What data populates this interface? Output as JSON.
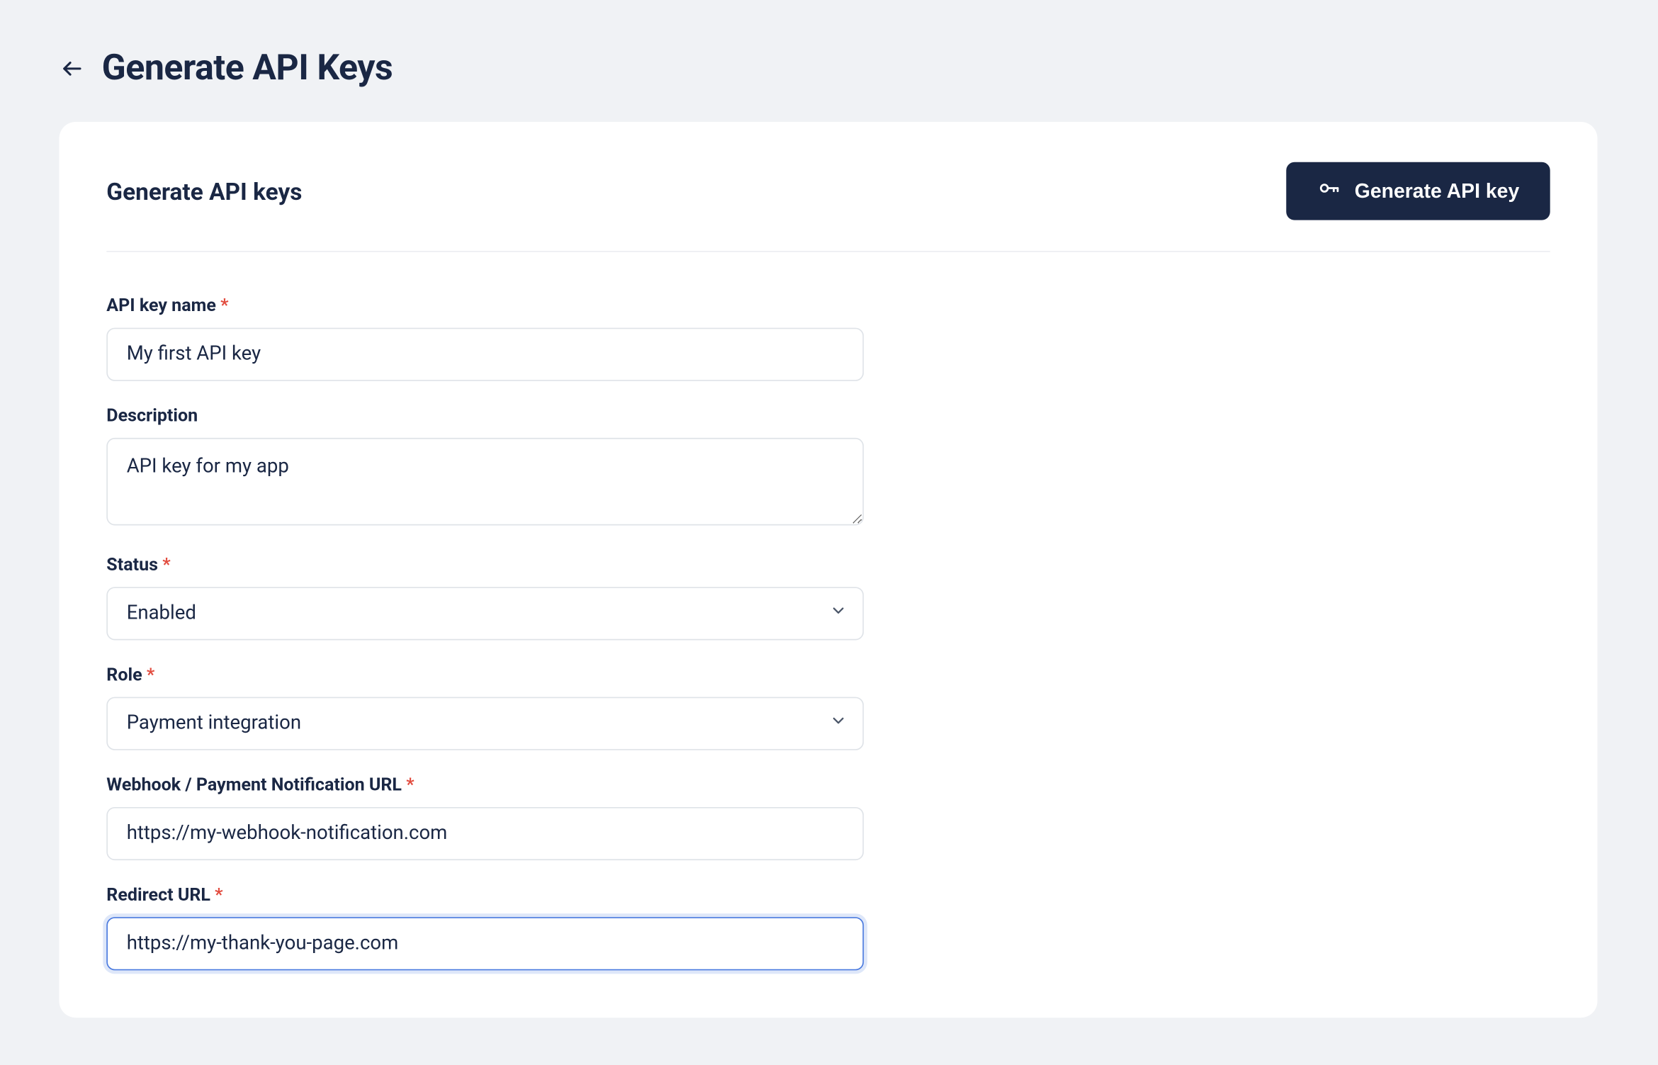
{
  "header": {
    "title": "Generate API Keys"
  },
  "card": {
    "title": "Generate API keys",
    "button_label": "Generate API key"
  },
  "form": {
    "name": {
      "label": "API key name",
      "required": true,
      "value": "My first API key"
    },
    "description": {
      "label": "Description",
      "required": false,
      "value": "API key for my app"
    },
    "status": {
      "label": "Status",
      "required": true,
      "value": "Enabled"
    },
    "role": {
      "label": "Role",
      "required": true,
      "value": "Payment integration"
    },
    "webhook": {
      "label": "Webhook / Payment Notification URL",
      "required": true,
      "value": "https://my-webhook-notification.com"
    },
    "redirect": {
      "label": "Redirect URL",
      "required": true,
      "value": "https://my-thank-you-page.com"
    }
  }
}
